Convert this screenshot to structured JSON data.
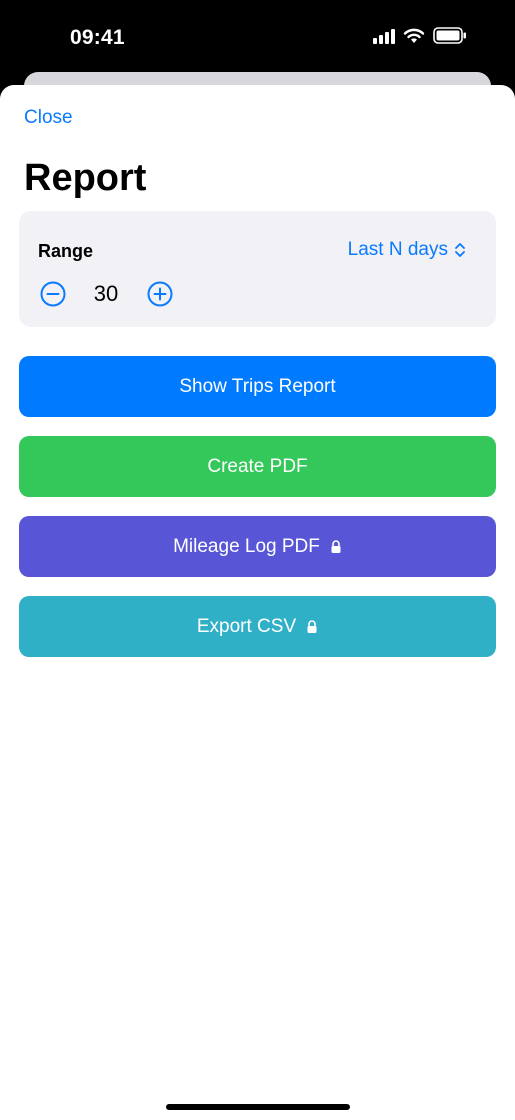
{
  "status_bar": {
    "time": "09:41"
  },
  "header": {
    "close_label": "Close",
    "title": "Report"
  },
  "range": {
    "label": "Range",
    "mode": "Last N days",
    "value": "30"
  },
  "actions": {
    "show_trips": {
      "label": "Show Trips Report",
      "color": "#007aff",
      "locked": false
    },
    "create_pdf": {
      "label": "Create PDF",
      "color": "#34c759",
      "locked": false
    },
    "mileage_log": {
      "label": "Mileage Log PDF",
      "color": "#5856d6",
      "locked": true
    },
    "export_csv": {
      "label": "Export CSV",
      "color": "#30b0c7",
      "locked": true
    }
  },
  "colors": {
    "accent": "#0a7aff",
    "card": "#f1f1f6"
  },
  "icons": [
    "signal-icon",
    "wifi-icon",
    "battery-icon",
    "minus-circle-icon",
    "plus-circle-icon",
    "chevron-updown-icon",
    "lock-icon"
  ]
}
